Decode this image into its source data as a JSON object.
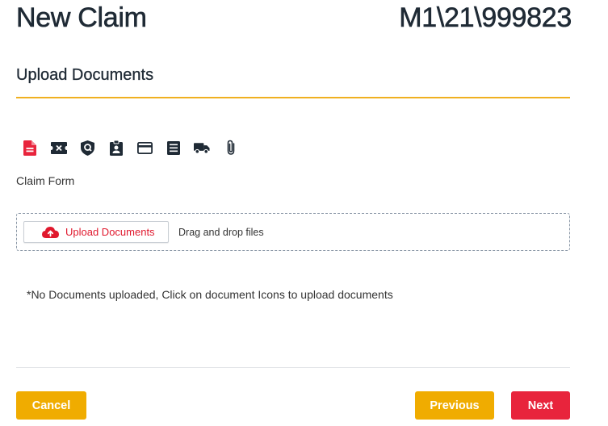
{
  "header": {
    "title": "New Claim",
    "claim_number": "M1\\21\\999823"
  },
  "section": {
    "title": "Upload Documents"
  },
  "document_types": [
    {
      "icon": "claim-form-icon",
      "active": true
    },
    {
      "icon": "ticket-icon",
      "active": false
    },
    {
      "icon": "shield-icon",
      "active": false
    },
    {
      "icon": "id-badge-icon",
      "active": false
    },
    {
      "icon": "credit-card-icon",
      "active": false
    },
    {
      "icon": "receipt-icon",
      "active": false
    },
    {
      "icon": "truck-icon",
      "active": false
    },
    {
      "icon": "paperclip-icon",
      "active": false
    }
  ],
  "selected_document": "Claim Form",
  "dropzone": {
    "upload_button_label": "Upload Documents",
    "drag_text": "Drag and drop files"
  },
  "note": "*No Documents uploaded, Click on document Icons to upload documents",
  "footer": {
    "cancel_label": "Cancel",
    "previous_label": "Previous",
    "next_label": "Next"
  },
  "colors": {
    "accent_yellow": "#f0ac00",
    "accent_red": "#e8243c",
    "title_text": "#1f2a35",
    "rule": "#f0b020"
  }
}
